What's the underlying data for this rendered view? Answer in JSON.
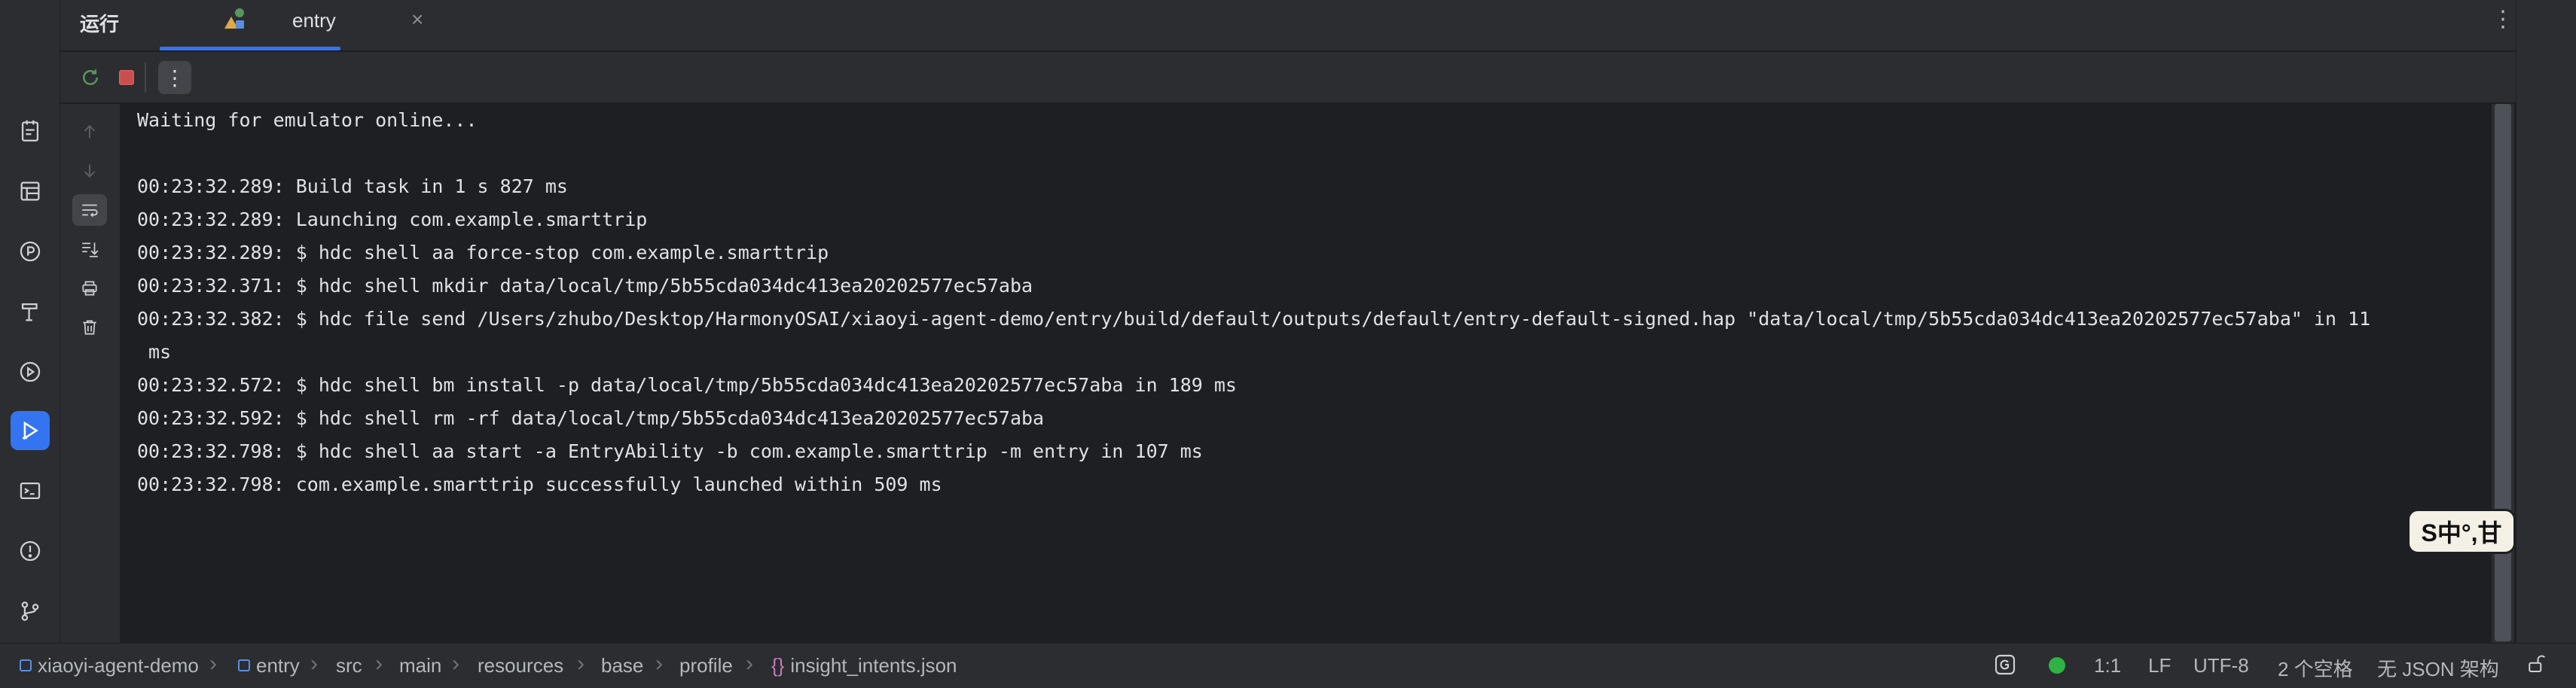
{
  "header": {
    "title": "运行",
    "tab_label": "entry",
    "tab_close": "×",
    "menu_glyph": "⋮"
  },
  "toolbar": {
    "more_glyph": "⋮"
  },
  "console": {
    "lines": [
      "Waiting for emulator online...",
      "",
      "00:23:32.289: Build task in 1 s 827 ms",
      "00:23:32.289: Launching com.example.smarttrip",
      "00:23:32.289: $ hdc shell aa force-stop com.example.smarttrip",
      "00:23:32.371: $ hdc shell mkdir data/local/tmp/5b55cda034dc413ea20202577ec57aba",
      "00:23:32.382: $ hdc file send /Users/zhubo/Desktop/HarmonyOSAI/xiaoyi-agent-demo/entry/build/default/outputs/default/entry-default-signed.hap \"data/local/tmp/5b55cda034dc413ea20202577ec57aba\" in 11",
      " ms",
      "00:23:32.572: $ hdc shell bm install -p data/local/tmp/5b55cda034dc413ea20202577ec57aba in 189 ms",
      "00:23:32.592: $ hdc shell rm -rf data/local/tmp/5b55cda034dc413ea20202577ec57aba",
      "00:23:32.798: $ hdc shell aa start -a EntryAbility -b com.example.smarttrip -m entry in 107 ms",
      "00:23:32.798: com.example.smarttrip successfully launched within 509 ms"
    ]
  },
  "ime": {
    "label": "S中°,甘"
  },
  "breadcrumb": {
    "items": [
      "xiaoyi-agent-demo",
      "entry",
      "src",
      "main",
      "resources",
      "base",
      "profile",
      "insight_intents.json"
    ],
    "separator": "›"
  },
  "status": {
    "position": "1:1",
    "line_sep": "LF",
    "encoding": "UTF-8",
    "indent": "2 个空格",
    "schema": "无 JSON 架构"
  },
  "colors": {
    "accent": "#3574f0",
    "stop_red": "#c94f4f",
    "rerun_green": "#57965c",
    "status_green": "#2fb344"
  }
}
